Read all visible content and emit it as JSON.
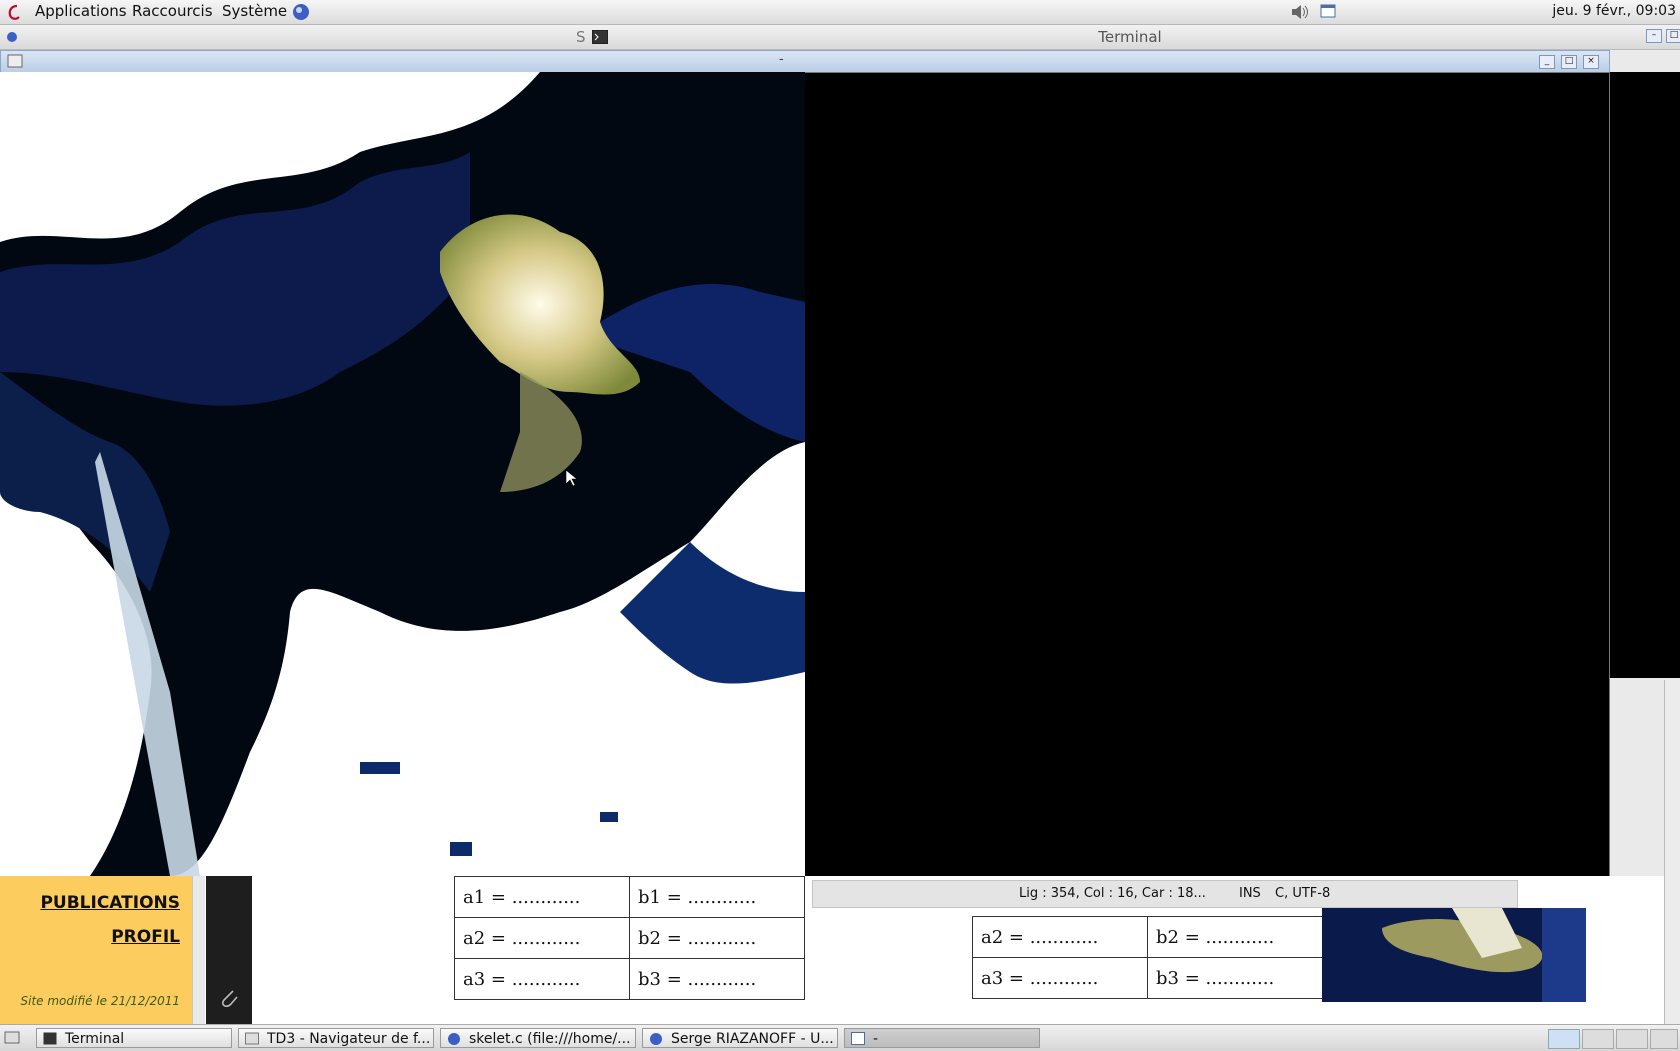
{
  "top_panel": {
    "menus": [
      "Applications",
      "Raccourcis",
      "Système"
    ],
    "clock": "jeu. 9 févr., 09:03"
  },
  "background_terminal": {
    "title": "Terminal",
    "left_fragment": "S"
  },
  "image_window": {
    "title": "-"
  },
  "editor_status": {
    "position": "Lig : 354, Col : 16, Car : 18...",
    "mode": "INS",
    "encoding": "C, UTF-8"
  },
  "web_page": {
    "sidebar_links": [
      "PUBLICATIONS",
      "PROFIL"
    ],
    "site_modified": "Site modifié le 21/12/2011",
    "left_table": [
      [
        "a1 = ............",
        "b1 = ............"
      ],
      [
        "a2 = ............",
        "b2 = ............"
      ],
      [
        "a3 = ............",
        "b3 = ............"
      ]
    ],
    "right_table": [
      [
        "a2 = ............",
        "b2 = ............"
      ],
      [
        "a3 = ............",
        "b3 = ............"
      ]
    ]
  },
  "taskbar": {
    "tasks": [
      "Terminal",
      "TD3 - Navigateur de f...",
      "skelet.c (file:///home/...",
      "Serge RIAZANOFF - U...",
      "-"
    ]
  }
}
